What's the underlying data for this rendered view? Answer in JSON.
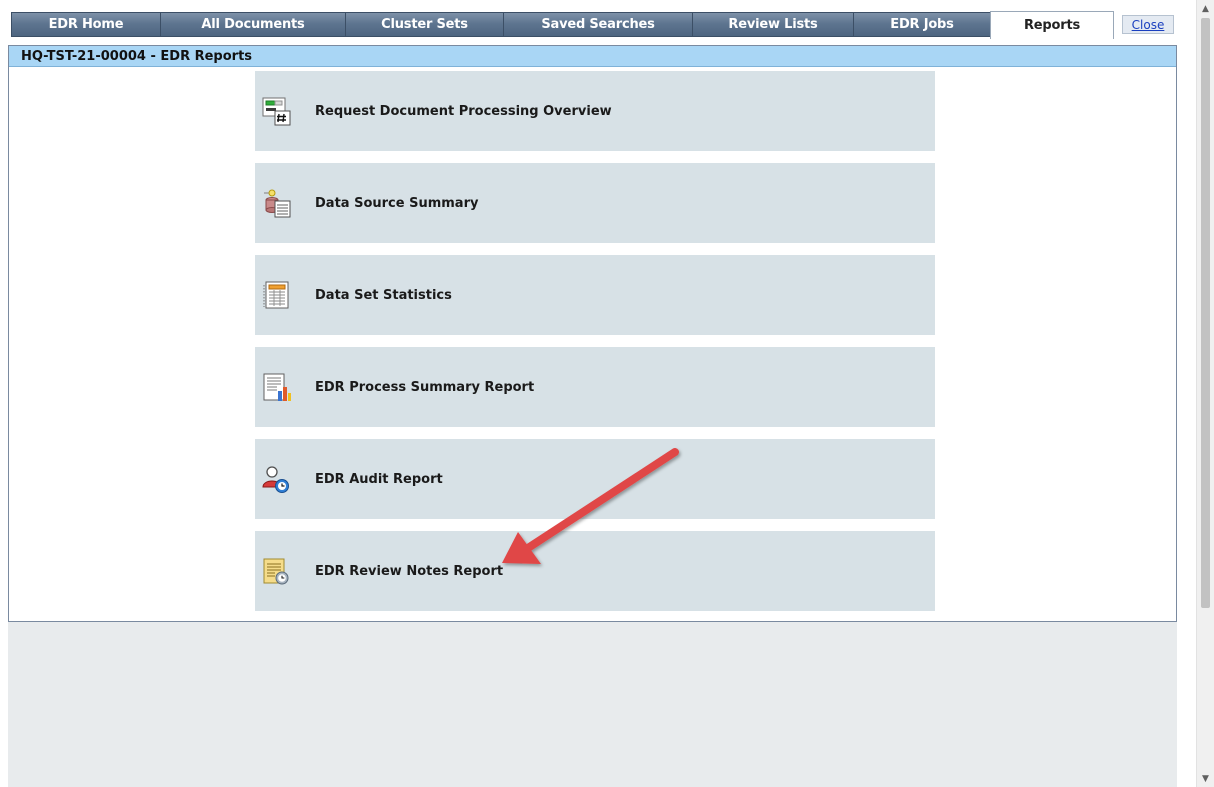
{
  "tabs": [
    {
      "label": "EDR Home",
      "active": false
    },
    {
      "label": "All Documents",
      "active": false
    },
    {
      "label": "Cluster Sets",
      "active": false
    },
    {
      "label": "Saved Searches",
      "active": false
    },
    {
      "label": "Review Lists",
      "active": false
    },
    {
      "label": "EDR Jobs",
      "active": false
    },
    {
      "label": "Reports",
      "active": true
    }
  ],
  "close_label": "Close",
  "panel": {
    "title": "HQ-TST-21-00004 - EDR Reports"
  },
  "reports": [
    {
      "label": "Request Document Processing Overview",
      "icon": "processing-overview-icon"
    },
    {
      "label": "Data Source Summary",
      "icon": "data-source-icon"
    },
    {
      "label": "Data Set Statistics",
      "icon": "statistics-sheet-icon"
    },
    {
      "label": "EDR Process Summary Report",
      "icon": "chart-report-icon"
    },
    {
      "label": "EDR Audit Report",
      "icon": "user-clock-icon"
    },
    {
      "label": "EDR Review Notes Report",
      "icon": "notes-clock-icon"
    }
  ],
  "colors": {
    "tab_bg": "#5e7590",
    "header_bg": "#a9d6f5",
    "item_bg": "#d7e1e6",
    "annotation_arrow": "#e04646"
  }
}
